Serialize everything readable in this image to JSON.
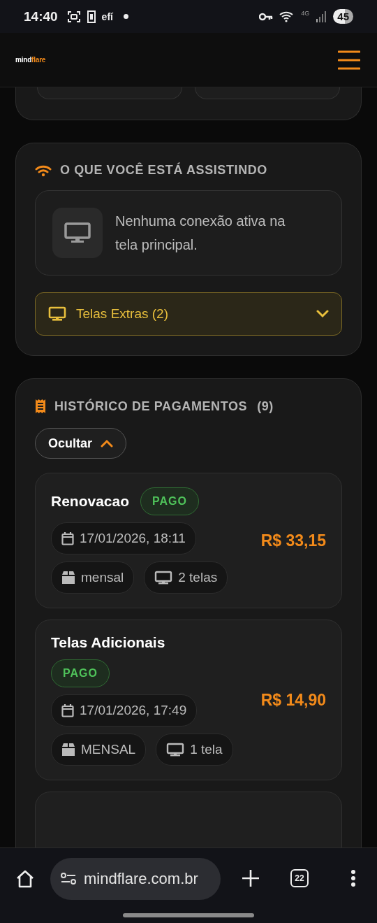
{
  "status_bar": {
    "time": "14:40",
    "notification_text": "efí",
    "network": "4G",
    "battery": "45"
  },
  "header": {
    "logo_main": "mind",
    "logo_accent": "flare"
  },
  "watching": {
    "title": "O QUE VOCÊ ESTÁ ASSISTINDO",
    "message": "Nenhuma conexão ativa na tela principal.",
    "extra_screens": {
      "label": "Telas Extras (2)",
      "expanded": false
    }
  },
  "payments": {
    "title": "HISTÓRICO DE PAGAMENTOS",
    "count": "(9)",
    "toggle": {
      "label": "Ocultar",
      "expanded": true
    },
    "items": [
      {
        "title": "Renovacao",
        "status": "PAGO",
        "date": "17/01/2026, 18:11",
        "plan": "mensal",
        "screens": "2 telas",
        "amount": "R$ 33,15"
      },
      {
        "title": "Telas Adicionais",
        "status": "PAGO",
        "date": "17/01/2026, 17:49",
        "plan": "MENSAL",
        "screens": "1 tela",
        "amount": "R$ 14,90"
      }
    ]
  },
  "browser": {
    "url": "mindflare.com.br",
    "tab_count": "22"
  }
}
